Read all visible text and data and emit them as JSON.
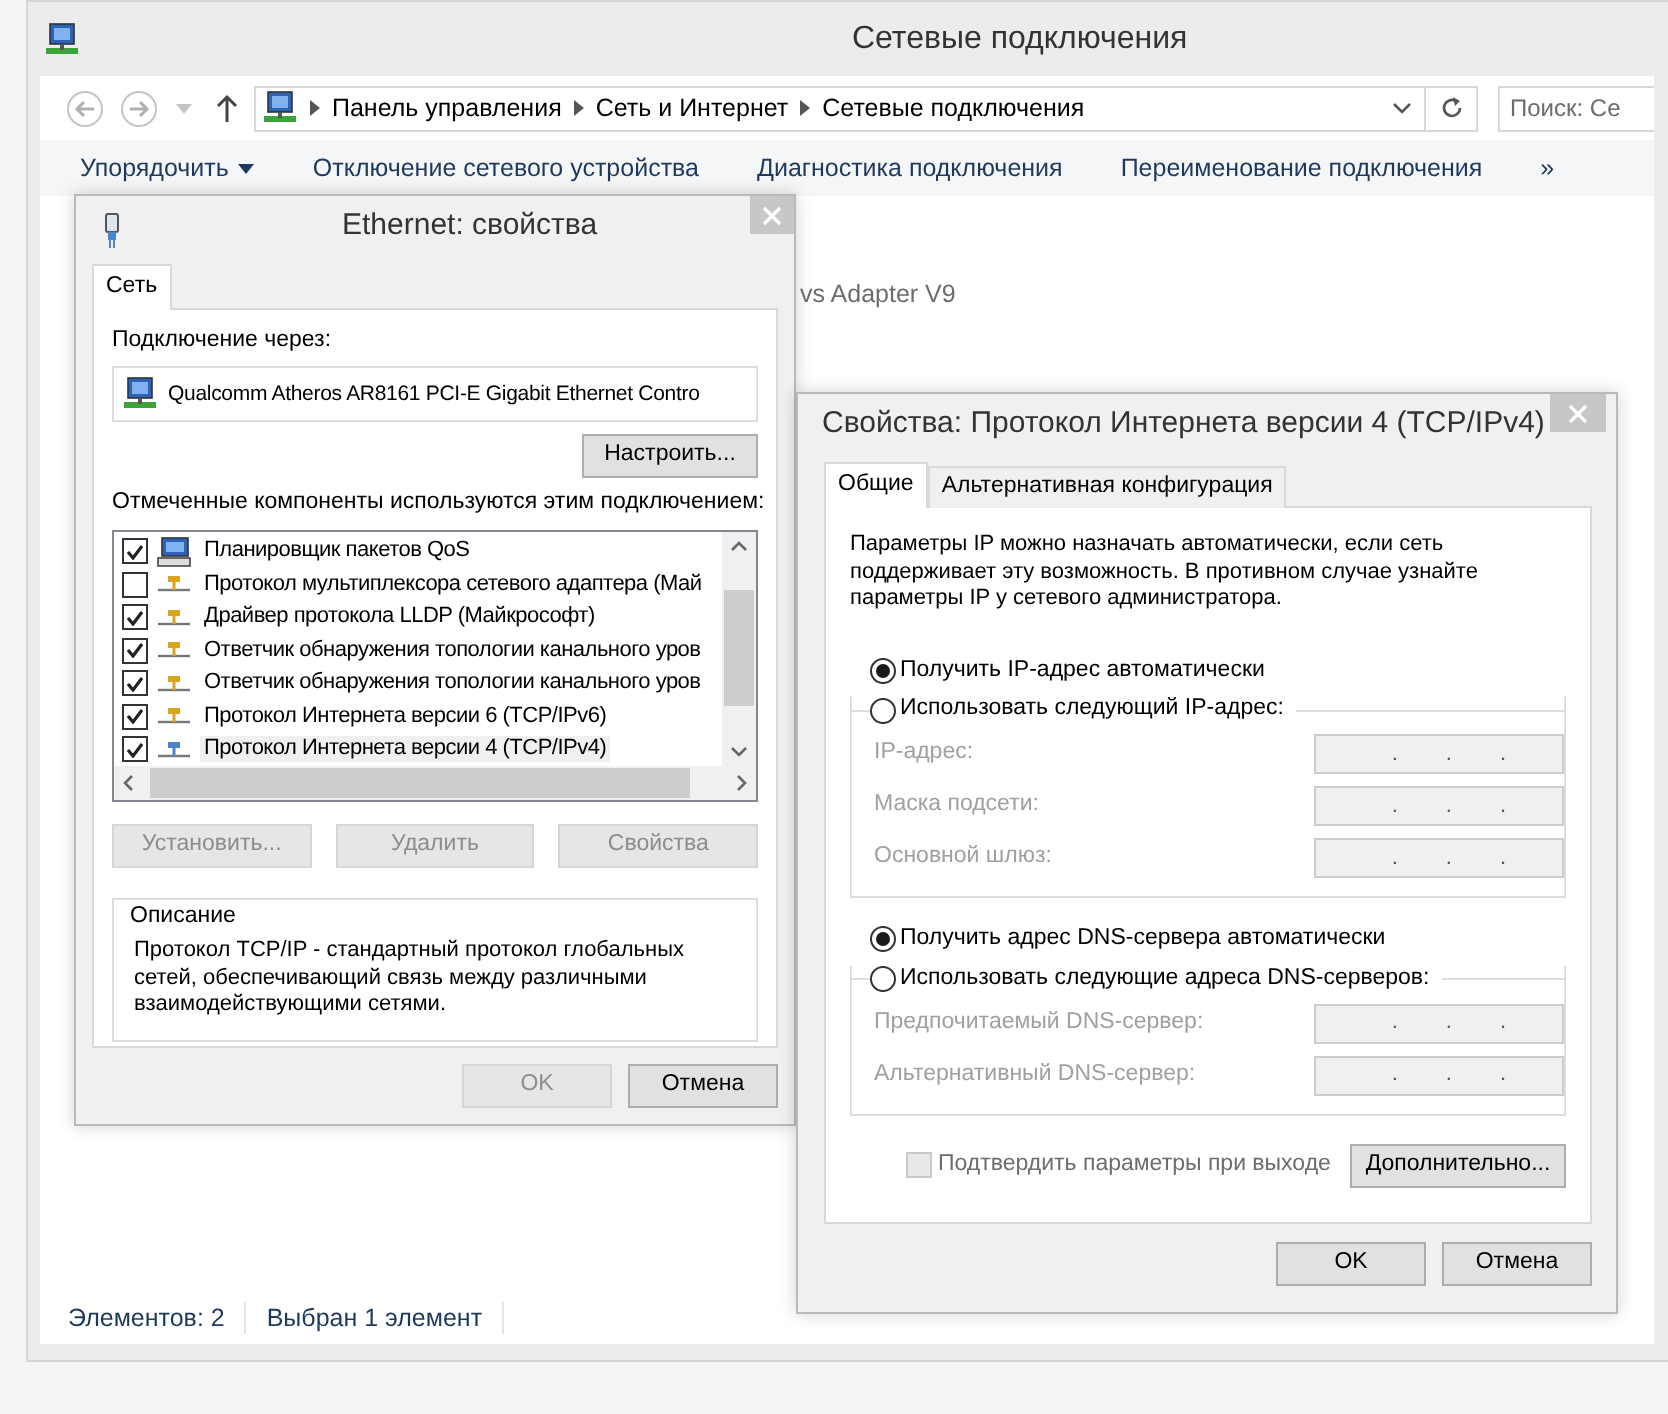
{
  "explorer": {
    "title": "Сетевые подключения",
    "breadcrumbs": [
      "Панель управления",
      "Сеть и Интернет",
      "Сетевые подключения"
    ],
    "search": {
      "placeholder": "Поиск: Се"
    },
    "toolbar": [
      {
        "label": "Упорядочить",
        "kind": "menu"
      },
      {
        "label": "Отключение сетевого устройства",
        "kind": "command"
      },
      {
        "label": "Диагностика подключения",
        "kind": "command"
      },
      {
        "label": "Переименование подключения",
        "kind": "command"
      },
      {
        "label": "»",
        "kind": "command"
      }
    ],
    "item_text": "vs Adapter V9",
    "status_bar": [
      "Элементов: 2",
      "Выбран 1 элемент"
    ]
  },
  "ethernet_dialog": {
    "title": "Ethernet: свойства",
    "tabs": [
      {
        "label": "Сеть",
        "selected": true
      }
    ],
    "connect_label": "Подключение через:",
    "adapter": "Qualcomm Atheros AR8161 PCI-E Gigabit Ethernet Contro",
    "configure_button": "Настроить...",
    "components_label": "Отмеченные компоненты используются этим подключением:",
    "components": [
      {
        "label": "Планировщик пакетов QoS",
        "kind": "service",
        "checked": true,
        "selected": false
      },
      {
        "label": "Протокол мультиплексора сетевого адаптера (Май",
        "kind": "protocol",
        "checked": false,
        "selected": false
      },
      {
        "label": "Драйвер протокола LLDP (Майкрософт)",
        "kind": "protocol",
        "checked": true,
        "selected": false
      },
      {
        "label": "Ответчик обнаружения топологии канального уров",
        "kind": "protocol",
        "checked": true,
        "selected": false
      },
      {
        "label": "Ответчик обнаружения топологии канального уров",
        "kind": "protocol",
        "checked": true,
        "selected": false
      },
      {
        "label": "Протокол Интернета версии 6 (TCP/IPv6)",
        "kind": "protocol",
        "checked": true,
        "selected": false
      },
      {
        "label": "Протокол Интернета версии 4 (TCP/IPv4)",
        "kind": "protocol",
        "checked": true,
        "selected": true
      }
    ],
    "buttons": [
      {
        "label": "Установить...",
        "disabled": true
      },
      {
        "label": "Удалить",
        "disabled": true
      },
      {
        "label": "Свойства",
        "disabled": true
      }
    ],
    "description_title": "Описание",
    "description": "Протокол TCP/IP - стандартный протокол глобальных сетей, обеспечивающий связь между различными взаимодействующими сетями.",
    "footer_buttons": [
      {
        "label": "OK",
        "disabled": true
      },
      {
        "label": "Отмена",
        "disabled": false
      }
    ]
  },
  "ipv4_dialog": {
    "title": "Свойства: Протокол Интернета версии 4 (TCP/IPv4)",
    "tabs": [
      {
        "label": "Общие",
        "selected": true
      },
      {
        "label": "Альтернативная конфигурация",
        "selected": false
      }
    ],
    "intro": "Параметры IP можно назначать автоматически, если сеть поддерживает эту возможность. В противном случае узнайте параметры IP у сетевого администратора.",
    "ip_options": [
      {
        "label": "Получить IP-адрес автоматически",
        "selected": true
      },
      {
        "label": "Использовать следующий IP-адрес:",
        "selected": false
      }
    ],
    "ip_fields": [
      {
        "label": "IP-адрес:",
        "disabled": true,
        "separators": [
          ".",
          ".",
          "."
        ]
      },
      {
        "label": "Маска подсети:",
        "disabled": true,
        "separators": [
          ".",
          ".",
          "."
        ]
      },
      {
        "label": "Основной шлюз:",
        "disabled": true,
        "separators": [
          ".",
          ".",
          "."
        ]
      }
    ],
    "dns_options": [
      {
        "label": "Получить адрес DNS-сервера автоматически",
        "selected": true
      },
      {
        "label": "Использовать следующие адреса DNS-серверов:",
        "selected": false
      }
    ],
    "dns_fields": [
      {
        "label": "Предпочитаемый DNS-сервер:",
        "disabled": true,
        "separators": [
          ".",
          ".",
          "."
        ]
      },
      {
        "label": "Альтернативный DNS-сервер:",
        "disabled": true,
        "separators": [
          ".",
          ".",
          "."
        ]
      }
    ],
    "validate": {
      "label": "Подтвердить параметры при выходе",
      "checked": false,
      "disabled": true
    },
    "advanced_button": "Дополнительно...",
    "footer_buttons": [
      {
        "label": "OK",
        "disabled": false
      },
      {
        "label": "Отмена",
        "disabled": false
      }
    ]
  }
}
